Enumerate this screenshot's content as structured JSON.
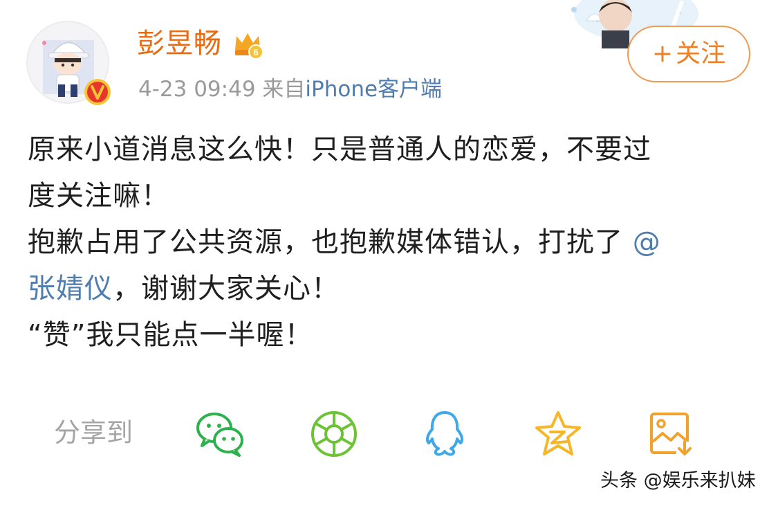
{
  "post": {
    "author": "彭昱畅",
    "time": "4-23 09:49",
    "source_prefix": "来自",
    "source": "iPhone客户端",
    "follow_plus": "+",
    "follow_label": "关注",
    "lines": {
      "l1": "原来小道消息这么快！只是普通人的恋爱，不要过",
      "l2": "度关注嘛！",
      "l3": "抱歉占用了公共资源，也抱歉媒体错认，打扰了",
      "l3_at": "@",
      "l4_mention": "张婧仪",
      "l4_rest": "，谢谢大家关心！",
      "l5": "“赞”我只能点一半喔！"
    }
  },
  "share": {
    "label": "分享到",
    "targets": [
      {
        "icon": "wechat-icon",
        "color": "#2bb24c"
      },
      {
        "icon": "moments-icon",
        "color": "#6dc236"
      },
      {
        "icon": "qq-icon",
        "color": "#3fa8e8"
      },
      {
        "icon": "qzone-icon",
        "color": "#f7b628"
      },
      {
        "icon": "save-image-icon",
        "color": "#f2a12b"
      }
    ]
  },
  "colors": {
    "username": "#e86b12",
    "link": "#507daf",
    "follow_border": "#f09a52",
    "meta": "#9a9a9a"
  },
  "watermark": "头条 @娱乐来扒妹"
}
